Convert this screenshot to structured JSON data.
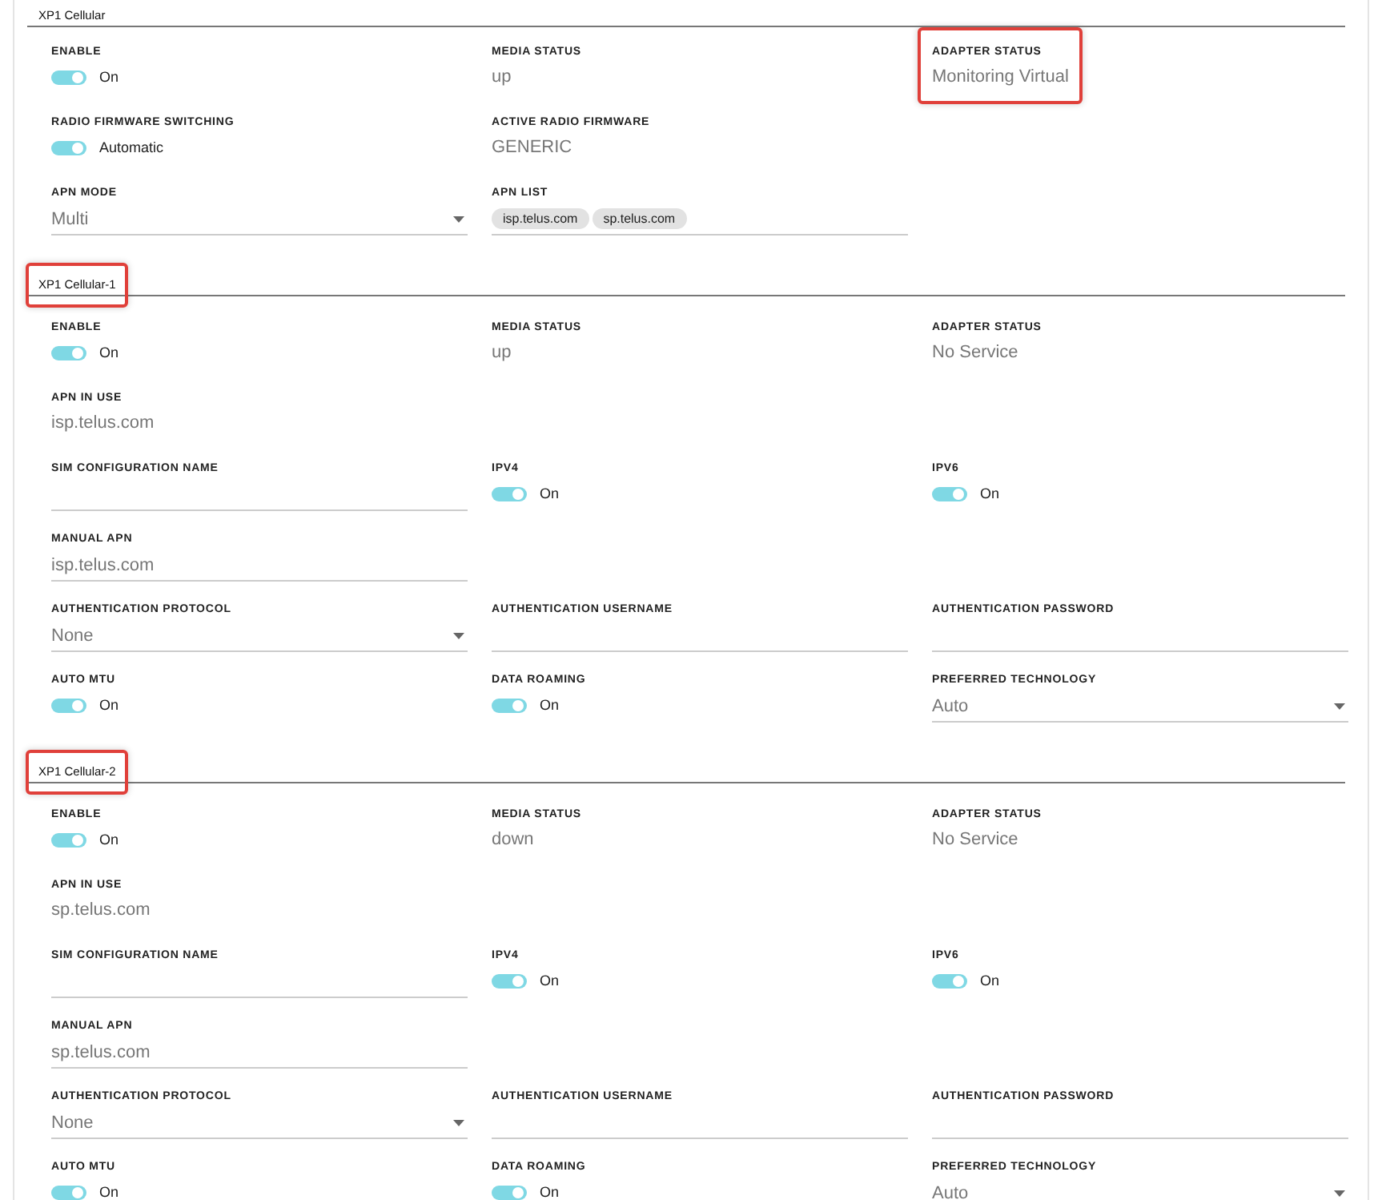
{
  "sections": [
    {
      "title": "XP1 Cellular",
      "highlighted": false,
      "rows": [
        [
          {
            "kind": "toggle",
            "label": "ENABLE",
            "on": true,
            "value": "On",
            "highlighted": false
          },
          {
            "kind": "text",
            "label": "MEDIA STATUS",
            "value": "up",
            "highlighted": false
          },
          {
            "kind": "text",
            "label": "ADAPTER STATUS",
            "value": "Monitoring Virtual",
            "highlighted": true
          }
        ],
        [
          {
            "kind": "toggle",
            "label": "RADIO FIRMWARE SWITCHING",
            "on": true,
            "value": "Automatic",
            "highlighted": false
          },
          {
            "kind": "text",
            "label": "ACTIVE RADIO FIRMWARE",
            "value": "GENERIC",
            "highlighted": false
          }
        ],
        [
          {
            "kind": "select",
            "label": "APN MODE",
            "value": "Multi",
            "highlighted": false
          },
          {
            "kind": "chips",
            "label": "APN LIST",
            "chips": [
              "isp.telus.com",
              "sp.telus.com"
            ],
            "highlighted": false
          }
        ]
      ]
    },
    {
      "title": "XP1 Cellular-1",
      "highlighted": true,
      "rows": [
        [
          {
            "kind": "toggle",
            "label": "ENABLE",
            "on": true,
            "value": "On",
            "highlighted": false
          },
          {
            "kind": "text",
            "label": "MEDIA STATUS",
            "value": "up",
            "highlighted": false
          },
          {
            "kind": "text",
            "label": "ADAPTER STATUS",
            "value": "No Service",
            "highlighted": false
          }
        ],
        [
          {
            "kind": "text",
            "label": "APN IN USE",
            "value": "isp.telus.com",
            "highlighted": false
          }
        ],
        [
          {
            "kind": "input",
            "label": "SIM CONFIGURATION NAME",
            "highlighted": false
          },
          {
            "kind": "toggle",
            "label": "IPV4",
            "on": true,
            "value": "On",
            "highlighted": false
          },
          {
            "kind": "toggle",
            "label": "IPV6",
            "on": true,
            "value": "On",
            "highlighted": false
          }
        ],
        [
          {
            "kind": "input",
            "label": "MANUAL APN",
            "value": "isp.telus.com",
            "highlighted": false
          }
        ],
        [
          {
            "kind": "select",
            "label": "AUTHENTICATION PROTOCOL",
            "value": "None",
            "highlighted": false
          },
          {
            "kind": "input",
            "label": "AUTHENTICATION USERNAME",
            "highlighted": false
          },
          {
            "kind": "input",
            "label": "AUTHENTICATION PASSWORD",
            "highlighted": false
          }
        ],
        [
          {
            "kind": "toggle",
            "label": "AUTO MTU",
            "on": true,
            "value": "On",
            "highlighted": false
          },
          {
            "kind": "toggle",
            "label": "DATA ROAMING",
            "on": true,
            "value": "On",
            "highlighted": false
          },
          {
            "kind": "select",
            "label": "PREFERRED TECHNOLOGY",
            "value": "Auto",
            "highlighted": false
          }
        ]
      ]
    },
    {
      "title": "XP1 Cellular-2",
      "highlighted": true,
      "rows": [
        [
          {
            "kind": "toggle",
            "label": "ENABLE",
            "on": true,
            "value": "On",
            "highlighted": false
          },
          {
            "kind": "text",
            "label": "MEDIA STATUS",
            "value": "down",
            "highlighted": false
          },
          {
            "kind": "text",
            "label": "ADAPTER STATUS",
            "value": "No Service",
            "highlighted": false
          }
        ],
        [
          {
            "kind": "text",
            "label": "APN IN USE",
            "value": "sp.telus.com",
            "highlighted": false
          }
        ],
        [
          {
            "kind": "input",
            "label": "SIM CONFIGURATION NAME",
            "highlighted": false
          },
          {
            "kind": "toggle",
            "label": "IPV4",
            "on": true,
            "value": "On",
            "highlighted": false
          },
          {
            "kind": "toggle",
            "label": "IPV6",
            "on": true,
            "value": "On",
            "highlighted": false
          }
        ],
        [
          {
            "kind": "input",
            "label": "MANUAL APN",
            "value": "sp.telus.com",
            "highlighted": false
          }
        ],
        [
          {
            "kind": "select",
            "label": "AUTHENTICATION PROTOCOL",
            "value": "None",
            "highlighted": false
          },
          {
            "kind": "input",
            "label": "AUTHENTICATION USERNAME",
            "highlighted": false
          },
          {
            "kind": "input",
            "label": "AUTHENTICATION PASSWORD",
            "highlighted": false
          }
        ],
        [
          {
            "kind": "toggle",
            "label": "AUTO MTU",
            "on": true,
            "value": "On",
            "highlighted": false
          },
          {
            "kind": "toggle",
            "label": "DATA ROAMING",
            "on": true,
            "value": "On",
            "highlighted": false
          },
          {
            "kind": "select",
            "label": "PREFERRED TECHNOLOGY",
            "value": "Auto",
            "highlighted": false
          }
        ]
      ]
    }
  ]
}
